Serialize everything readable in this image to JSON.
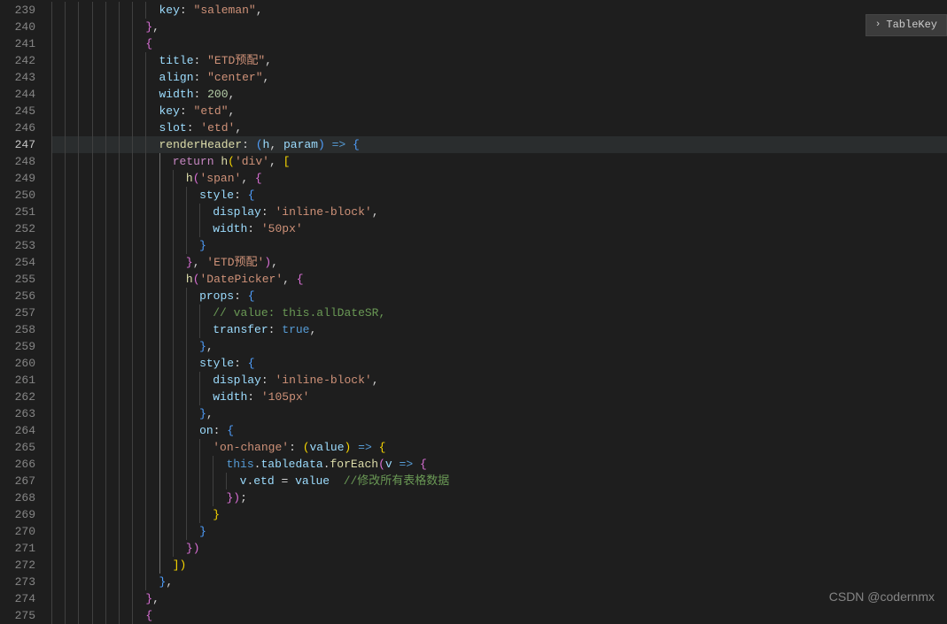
{
  "breadcrumb": {
    "label": "TableKey"
  },
  "watermark": "CSDN @codernmx",
  "active_line": 247,
  "lines": [
    {
      "n": 239,
      "i": 8,
      "text": "key: \"saleman\","
    },
    {
      "n": 240,
      "i": 7,
      "text": "},"
    },
    {
      "n": 241,
      "i": 7,
      "text": "{"
    },
    {
      "n": 242,
      "i": 8,
      "text": "title: \"ETD预配\","
    },
    {
      "n": 243,
      "i": 8,
      "text": "align: \"center\","
    },
    {
      "n": 244,
      "i": 8,
      "text": "width: 200,"
    },
    {
      "n": 245,
      "i": 8,
      "text": "key: \"etd\","
    },
    {
      "n": 246,
      "i": 8,
      "text": "slot: 'etd',"
    },
    {
      "n": 247,
      "i": 8,
      "text": "renderHeader: (h, param) => {"
    },
    {
      "n": 248,
      "i": 9,
      "text": "return h('div', ["
    },
    {
      "n": 249,
      "i": 10,
      "text": "h('span', {"
    },
    {
      "n": 250,
      "i": 11,
      "text": "style: {"
    },
    {
      "n": 251,
      "i": 12,
      "text": "display: 'inline-block',"
    },
    {
      "n": 252,
      "i": 12,
      "text": "width: '50px'"
    },
    {
      "n": 253,
      "i": 11,
      "text": "}"
    },
    {
      "n": 254,
      "i": 10,
      "text": "}, 'ETD预配'),"
    },
    {
      "n": 255,
      "i": 10,
      "text": "h('DatePicker', {"
    },
    {
      "n": 256,
      "i": 11,
      "text": "props: {"
    },
    {
      "n": 257,
      "i": 12,
      "text": "// value: this.allDateSR,"
    },
    {
      "n": 258,
      "i": 12,
      "text": "transfer: true,"
    },
    {
      "n": 259,
      "i": 11,
      "text": "},"
    },
    {
      "n": 260,
      "i": 11,
      "text": "style: {"
    },
    {
      "n": 261,
      "i": 12,
      "text": "display: 'inline-block',"
    },
    {
      "n": 262,
      "i": 12,
      "text": "width: '105px'"
    },
    {
      "n": 263,
      "i": 11,
      "text": "},"
    },
    {
      "n": 264,
      "i": 11,
      "text": "on: {"
    },
    {
      "n": 265,
      "i": 12,
      "text": "'on-change': (value) => {"
    },
    {
      "n": 266,
      "i": 13,
      "text": "this.tabledata.forEach(v => {"
    },
    {
      "n": 267,
      "i": 14,
      "text": "v.etd = value  //修改所有表格数据"
    },
    {
      "n": 268,
      "i": 13,
      "text": "});"
    },
    {
      "n": 269,
      "i": 12,
      "text": "}"
    },
    {
      "n": 270,
      "i": 11,
      "text": "}"
    },
    {
      "n": 271,
      "i": 10,
      "text": "})"
    },
    {
      "n": 272,
      "i": 9,
      "text": "])"
    },
    {
      "n": 273,
      "i": 8,
      "text": "},"
    },
    {
      "n": 274,
      "i": 7,
      "text": "},"
    },
    {
      "n": 275,
      "i": 7,
      "text": "{"
    }
  ],
  "tokens": {
    "239": [
      [
        "t-key",
        "key"
      ],
      [
        "t-pun",
        ": "
      ],
      [
        "t-str",
        "\"saleman\""
      ],
      [
        "t-pun",
        ","
      ]
    ],
    "240": [
      [
        "t-br1",
        "}"
      ],
      [
        "t-pun",
        ","
      ]
    ],
    "241": [
      [
        "t-br1",
        "{"
      ]
    ],
    "242": [
      [
        "t-key",
        "title"
      ],
      [
        "t-pun",
        ": "
      ],
      [
        "t-str",
        "\"ETD预配\""
      ],
      [
        "t-pun",
        ","
      ]
    ],
    "243": [
      [
        "t-key",
        "align"
      ],
      [
        "t-pun",
        ": "
      ],
      [
        "t-str",
        "\"center\""
      ],
      [
        "t-pun",
        ","
      ]
    ],
    "244": [
      [
        "t-key",
        "width"
      ],
      [
        "t-pun",
        ": "
      ],
      [
        "t-num",
        "200"
      ],
      [
        "t-pun",
        ","
      ]
    ],
    "245": [
      [
        "t-key",
        "key"
      ],
      [
        "t-pun",
        ": "
      ],
      [
        "t-str",
        "\"etd\""
      ],
      [
        "t-pun",
        ","
      ]
    ],
    "246": [
      [
        "t-key",
        "slot"
      ],
      [
        "t-pun",
        ": "
      ],
      [
        "t-str",
        "'etd'"
      ],
      [
        "t-pun",
        ","
      ]
    ],
    "247": [
      [
        "t-fun",
        "renderHeader"
      ],
      [
        "t-pun",
        ": "
      ],
      [
        "t-br2",
        "("
      ],
      [
        "t-param",
        "h"
      ],
      [
        "t-pun",
        ", "
      ],
      [
        "t-param",
        "param"
      ],
      [
        "t-br2",
        ")"
      ],
      [
        "t-pun",
        " "
      ],
      [
        "t-kw2",
        "=>"
      ],
      [
        "t-pun",
        " "
      ],
      [
        "t-br2",
        "{"
      ]
    ],
    "248": [
      [
        "t-kw",
        "return"
      ],
      [
        "t-pun",
        " "
      ],
      [
        "t-fun",
        "h"
      ],
      [
        "t-br3",
        "("
      ],
      [
        "t-str",
        "'div'"
      ],
      [
        "t-pun",
        ", "
      ],
      [
        "t-br3",
        "["
      ]
    ],
    "249": [
      [
        "t-fun",
        "h"
      ],
      [
        "t-br1",
        "("
      ],
      [
        "t-str",
        "'span'"
      ],
      [
        "t-pun",
        ", "
      ],
      [
        "t-br1",
        "{"
      ]
    ],
    "250": [
      [
        "t-key",
        "style"
      ],
      [
        "t-pun",
        ": "
      ],
      [
        "t-br2",
        "{"
      ]
    ],
    "251": [
      [
        "t-key",
        "display"
      ],
      [
        "t-pun",
        ": "
      ],
      [
        "t-str",
        "'inline-block'"
      ],
      [
        "t-pun",
        ","
      ]
    ],
    "252": [
      [
        "t-key",
        "width"
      ],
      [
        "t-pun",
        ": "
      ],
      [
        "t-str",
        "'50px'"
      ]
    ],
    "253": [
      [
        "t-br2",
        "}"
      ]
    ],
    "254": [
      [
        "t-br1",
        "}"
      ],
      [
        "t-pun",
        ", "
      ],
      [
        "t-str",
        "'ETD预配'"
      ],
      [
        "t-br1",
        ")"
      ],
      [
        "t-pun",
        ","
      ]
    ],
    "255": [
      [
        "t-fun",
        "h"
      ],
      [
        "t-br1",
        "("
      ],
      [
        "t-str",
        "'DatePicker'"
      ],
      [
        "t-pun",
        ", "
      ],
      [
        "t-br1",
        "{"
      ]
    ],
    "256": [
      [
        "t-key",
        "props"
      ],
      [
        "t-pun",
        ": "
      ],
      [
        "t-br2",
        "{"
      ]
    ],
    "257": [
      [
        "t-cmt",
        "// value: this.allDateSR,"
      ]
    ],
    "258": [
      [
        "t-key",
        "transfer"
      ],
      [
        "t-pun",
        ": "
      ],
      [
        "t-const",
        "true"
      ],
      [
        "t-pun",
        ","
      ]
    ],
    "259": [
      [
        "t-br2",
        "}"
      ],
      [
        "t-pun",
        ","
      ]
    ],
    "260": [
      [
        "t-key",
        "style"
      ],
      [
        "t-pun",
        ": "
      ],
      [
        "t-br2",
        "{"
      ]
    ],
    "261": [
      [
        "t-key",
        "display"
      ],
      [
        "t-pun",
        ": "
      ],
      [
        "t-str",
        "'inline-block'"
      ],
      [
        "t-pun",
        ","
      ]
    ],
    "262": [
      [
        "t-key",
        "width"
      ],
      [
        "t-pun",
        ": "
      ],
      [
        "t-str",
        "'105px'"
      ]
    ],
    "263": [
      [
        "t-br2",
        "}"
      ],
      [
        "t-pun",
        ","
      ]
    ],
    "264": [
      [
        "t-key",
        "on"
      ],
      [
        "t-pun",
        ": "
      ],
      [
        "t-br2",
        "{"
      ]
    ],
    "265": [
      [
        "t-str",
        "'on-change'"
      ],
      [
        "t-pun",
        ": "
      ],
      [
        "t-br3",
        "("
      ],
      [
        "t-param",
        "value"
      ],
      [
        "t-br3",
        ")"
      ],
      [
        "t-pun",
        " "
      ],
      [
        "t-kw2",
        "=>"
      ],
      [
        "t-pun",
        " "
      ],
      [
        "t-br3",
        "{"
      ]
    ],
    "266": [
      [
        "t-kw2",
        "this"
      ],
      [
        "t-pun",
        "."
      ],
      [
        "t-mem",
        "tabledata"
      ],
      [
        "t-pun",
        "."
      ],
      [
        "t-fun",
        "forEach"
      ],
      [
        "t-br1",
        "("
      ],
      [
        "t-param",
        "v"
      ],
      [
        "t-pun",
        " "
      ],
      [
        "t-kw2",
        "=>"
      ],
      [
        "t-pun",
        " "
      ],
      [
        "t-br1",
        "{"
      ]
    ],
    "267": [
      [
        "t-mem",
        "v"
      ],
      [
        "t-pun",
        "."
      ],
      [
        "t-mem",
        "etd"
      ],
      [
        "t-pun",
        " = "
      ],
      [
        "t-mem",
        "value"
      ],
      [
        "t-pun",
        "  "
      ],
      [
        "t-cmt",
        "//修改所有表格数据"
      ]
    ],
    "268": [
      [
        "t-br1",
        "}"
      ],
      [
        "t-br1",
        ")"
      ],
      [
        "t-pun",
        ";"
      ]
    ],
    "269": [
      [
        "t-br3",
        "}"
      ]
    ],
    "270": [
      [
        "t-br2",
        "}"
      ]
    ],
    "271": [
      [
        "t-br1",
        "}"
      ],
      [
        "t-br1",
        ")"
      ]
    ],
    "272": [
      [
        "t-br3",
        "]"
      ],
      [
        "t-br3",
        ")"
      ]
    ],
    "273": [
      [
        "t-br2",
        "}"
      ],
      [
        "t-pun",
        ","
      ]
    ],
    "274": [
      [
        "t-br1",
        "}"
      ],
      [
        "t-pun",
        ","
      ]
    ],
    "275": [
      [
        "t-br1",
        "{"
      ]
    ]
  }
}
